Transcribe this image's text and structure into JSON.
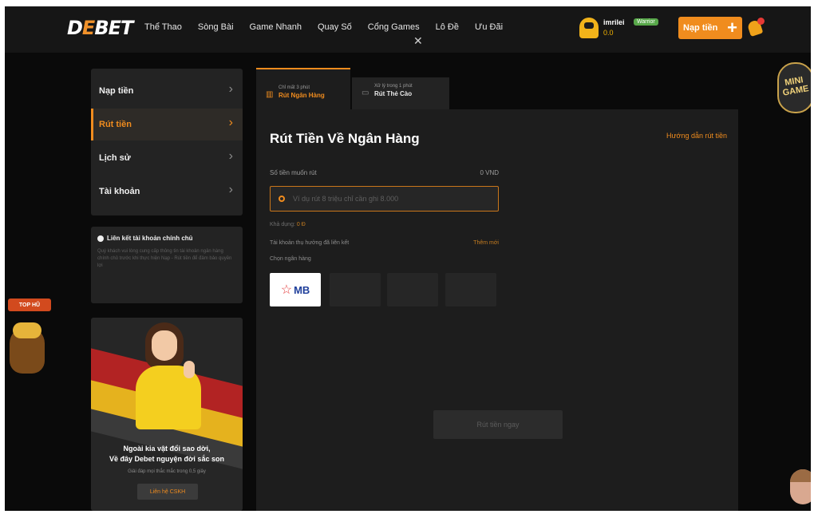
{
  "header": {
    "logo_main": "D",
    "logo_accent": "E",
    "logo_rest": "BET",
    "nav": [
      "Thể Thao",
      "Sòng Bài",
      "Game Nhanh",
      "Quay Số",
      "Cổng Games",
      "Lô Đề",
      "Ưu Đãi"
    ],
    "close_glyph": "✕",
    "username": "imrilei",
    "user_badge": "Warrior",
    "balance": "0.0",
    "deposit_label": "Nạp tiền",
    "deposit_plus": "+"
  },
  "sidebar": {
    "items": [
      {
        "label": "Nạp tiền",
        "active": false
      },
      {
        "label": "Rút tiền",
        "active": true
      },
      {
        "label": "Lịch sử",
        "active": false
      },
      {
        "label": "Tài khoản",
        "active": false
      }
    ],
    "chevron": "›",
    "info_title": "Liên kết tài khoản chính chủ",
    "info_desc": "Quý khách vui lòng cung cấp thông tin tài khoản ngân hàng chính chủ trước khi thực hiện Nạp - Rút tiền để đảm bảo quyền lợi",
    "promo_line1": "Ngoài kia vật đổi sao dời,",
    "promo_line2": "Về đây Debet nguyện đời sắc son",
    "promo_sub": "Giải đáp mọi thắc mắc trong 0,5 giây",
    "promo_button": "Liên hệ CSKH"
  },
  "tabs": [
    {
      "sub": "Chỉ mất 3 phút",
      "label": "Rút Ngân Hàng",
      "active": true
    },
    {
      "sub": "Xử lý trong 1 phút",
      "label": "Rút Thẻ Cào",
      "active": false
    }
  ],
  "form": {
    "title": "Rút Tiền Về Ngân Hàng",
    "guide_link": "Hướng dẫn rút tiền",
    "amount_label": "Số tiền muốn rút",
    "amount_unit": "0 VND",
    "amount_placeholder": "Ví dụ rút 8 triệu chỉ cần ghi 8.000",
    "available_label": "Khả dụng: ",
    "available_value": "0 Đ",
    "account_label": "Tài khoản thụ hưởng đã liên kết",
    "add_new": "Thêm mới",
    "choose_bank": "Chọn ngân hàng",
    "bank_mb": "MB",
    "bank_mb_star": "☆",
    "submit": "Rút tiền ngay"
  },
  "floating": {
    "minigame": "MINI GAME",
    "tophu": "TOP HŨ"
  },
  "colors": {
    "accent": "#f08c1e",
    "background": "#0a0a0a",
    "panel": "#1d1d1d"
  }
}
